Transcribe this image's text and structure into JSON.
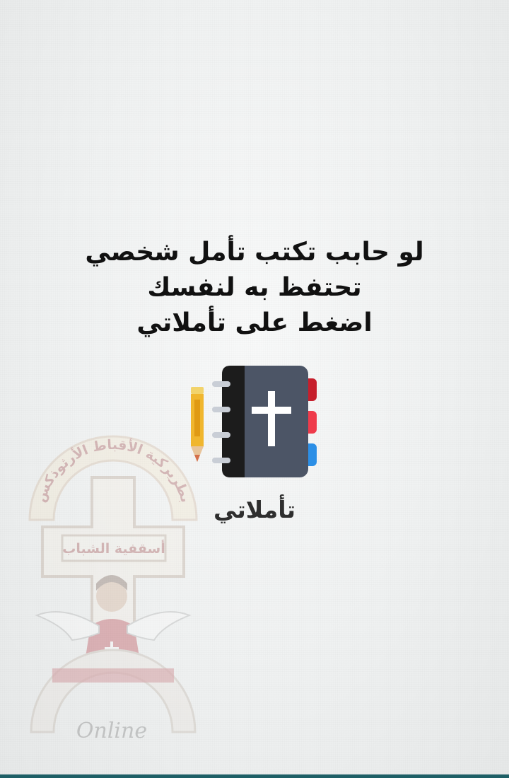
{
  "message": {
    "line1": "لو حابب تكتب تأمل شخصي",
    "line2": "تحتفظ به لنفسك",
    "line3": "اضغط على تأملاتي"
  },
  "app": {
    "label": "تأملاتي",
    "icon": "journal-cross-icon"
  },
  "watermark": {
    "arc_text": "بطريركية الأقباط الأرثوذكس",
    "banner_text": "أسقفية الشباب",
    "footer_text": "Online"
  },
  "colors": {
    "book_cover": "#4c5566",
    "book_spine": "#1c1c1c",
    "tab_red": "#c61f2c",
    "tab_pink": "#ef3b4b",
    "tab_blue": "#2c8fe6",
    "pencil": "#f0b62e",
    "bottom_bar": "#1e5f66"
  }
}
